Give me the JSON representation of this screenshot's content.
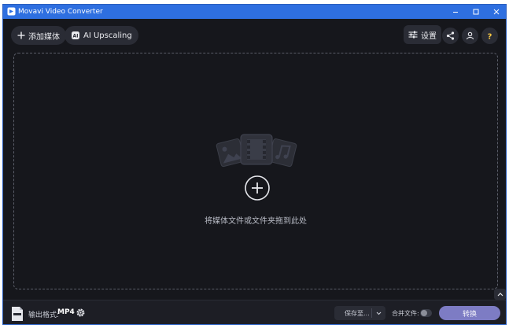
{
  "window": {
    "title": "Movavi Video Converter",
    "controls": [
      "minimize-icon",
      "maximize-icon",
      "close-icon"
    ]
  },
  "toolbar": {
    "add_media_label": "添加媒体",
    "ai_upscaling_label": "AI Upscaling",
    "settings_label": "设置"
  },
  "dropzone": {
    "hint": "将媒体文件或文件夹拖到此处"
  },
  "bottom": {
    "output_format_label": "输出格式:",
    "output_format_value": "MP4",
    "save_to_label": "保存至...",
    "merge_label": "合并文件:",
    "convert_label": "转换"
  },
  "colors": {
    "titlebar": "#2e6fe0",
    "background": "#16171c",
    "button": "#2a2c35",
    "convert_button": "#7d7cc4",
    "help_accent": "#f5c542"
  }
}
